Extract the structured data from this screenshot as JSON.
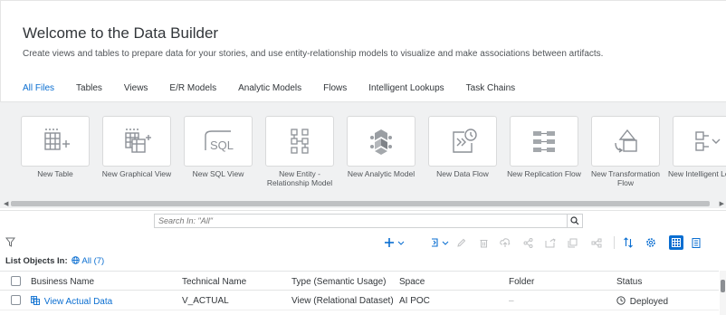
{
  "header": {
    "title": "Welcome to the Data Builder",
    "subtitle": "Create views and tables to prepare data for your stories, and use entity-relationship models to visualize and make associations between artifacts."
  },
  "tabs": [
    {
      "label": "All Files",
      "active": true
    },
    {
      "label": "Tables"
    },
    {
      "label": "Views"
    },
    {
      "label": "E/R Models"
    },
    {
      "label": "Analytic Models"
    },
    {
      "label": "Flows"
    },
    {
      "label": "Intelligent Lookups"
    },
    {
      "label": "Task Chains"
    }
  ],
  "tiles": [
    {
      "label": "New Table",
      "icon": "table-add-icon"
    },
    {
      "label": "New Graphical View",
      "icon": "graphical-view-icon"
    },
    {
      "label": "New SQL View",
      "icon": "sql-view-icon"
    },
    {
      "label": "New Entity - Relationship Model",
      "icon": "er-model-icon"
    },
    {
      "label": "New Analytic Model",
      "icon": "analytic-model-icon"
    },
    {
      "label": "New Data Flow",
      "icon": "data-flow-icon"
    },
    {
      "label": "New Replication Flow",
      "icon": "replication-flow-icon"
    },
    {
      "label": "New Transformation Flow",
      "icon": "transformation-flow-icon"
    },
    {
      "label": "New Intelligent Lookup",
      "icon": "intelligent-lookup-icon"
    }
  ],
  "search": {
    "placeholder": "Search In: \"All\""
  },
  "list": {
    "label": "List Objects In:",
    "scope": "All (7)"
  },
  "table": {
    "columns": [
      "Business Name",
      "Technical Name",
      "Type (Semantic Usage)",
      "Space",
      "Folder",
      "Status"
    ],
    "rows": [
      {
        "business_name": "View Actual Data",
        "technical_name": "V_ACTUAL",
        "type": "View (Relational Dataset)",
        "space": "AI POC",
        "folder": "–",
        "status": "Deployed"
      }
    ]
  },
  "colors": {
    "accent": "#0a6ed1",
    "tile_bg": "#f0f1f2",
    "icon": "#8c9096"
  }
}
